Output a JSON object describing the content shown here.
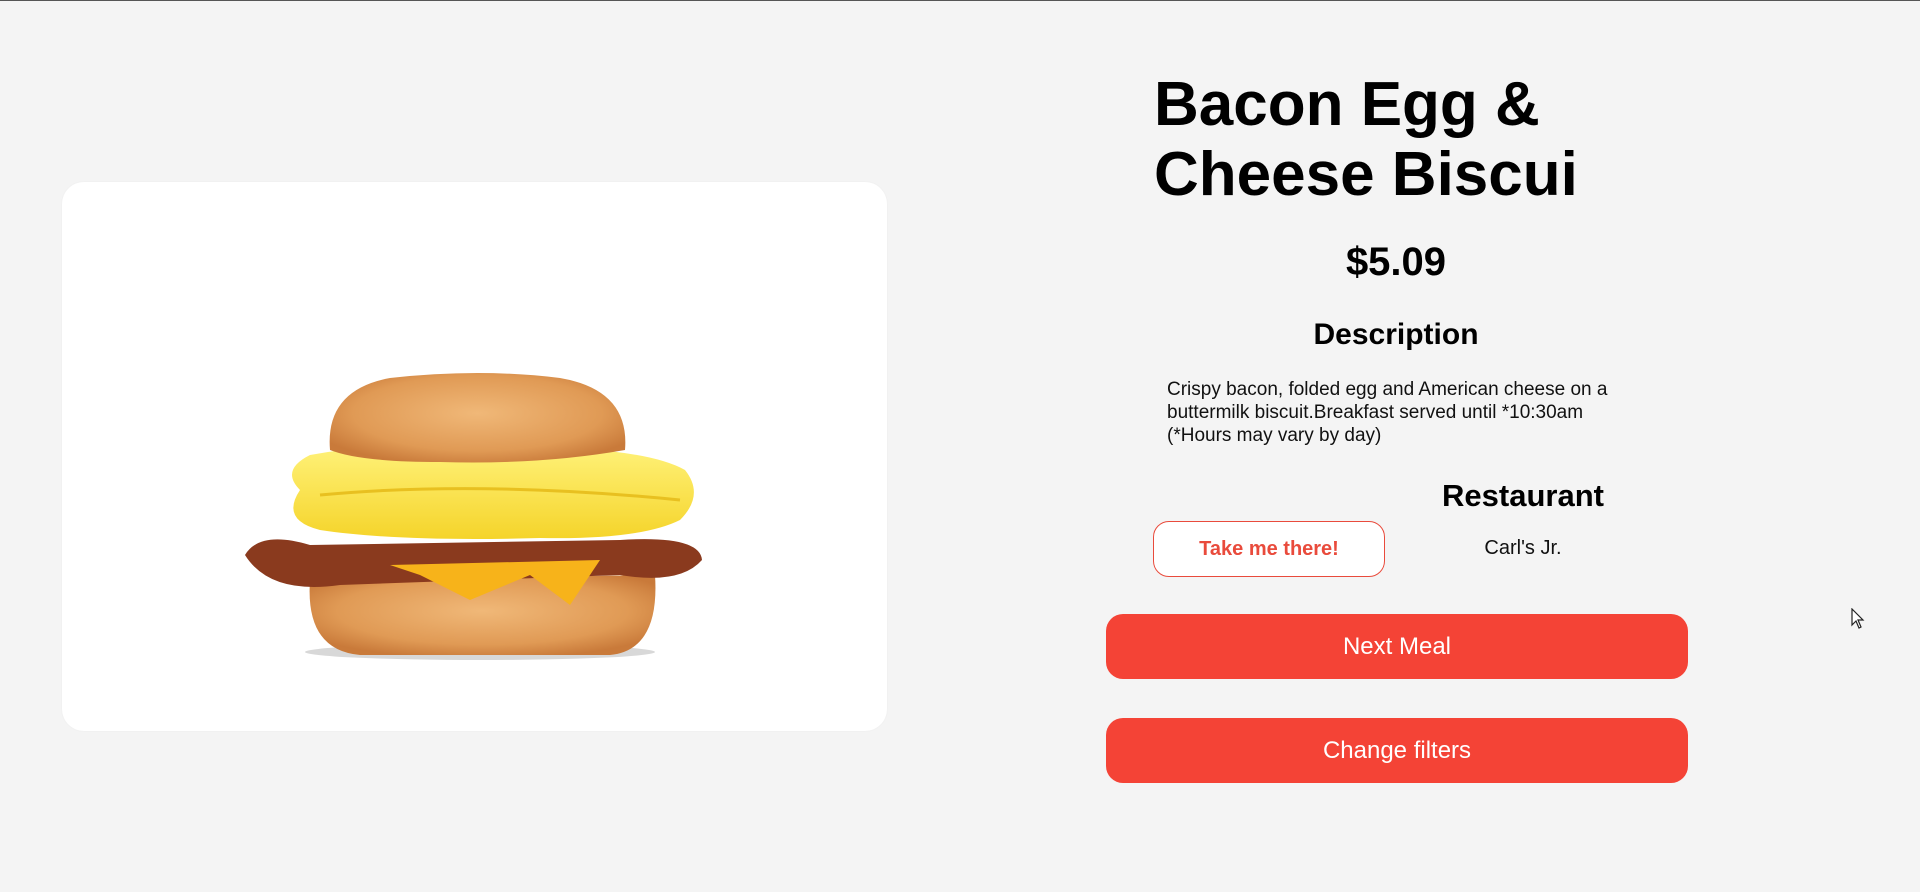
{
  "meal": {
    "name": "Bacon Egg & Cheese Biscui",
    "price": "$5.09",
    "image_icon": "biscuit-sandwich-image",
    "description_heading": "Description",
    "description": "Crispy bacon, folded egg and American cheese on a buttermilk biscuit.Breakfast served until *10:30am (*Hours may vary by day)"
  },
  "restaurant": {
    "heading": "Restaurant",
    "take_label": "Take me there!",
    "name": "Carl's Jr."
  },
  "actions": {
    "next_label": "Next Meal",
    "filters_label": "Change filters"
  },
  "colors": {
    "accent": "#f44336",
    "background": "#f4f4f4",
    "card": "#ffffff"
  }
}
